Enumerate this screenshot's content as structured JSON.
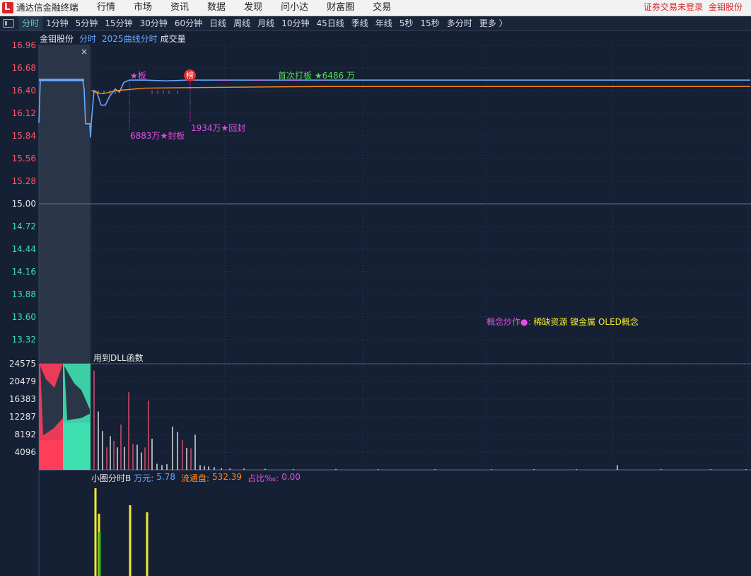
{
  "app": {
    "title": "通达信金融终端",
    "logo_glyph": "L"
  },
  "menu": [
    "行情",
    "市场",
    "资讯",
    "数据",
    "发现",
    "问小达",
    "财富圈",
    "交易"
  ],
  "right_menu": {
    "login": "证券交易未登录",
    "stock": "金钼股份"
  },
  "periods": [
    "分时",
    "1分钟",
    "5分钟",
    "15分钟",
    "30分钟",
    "60分钟",
    "日线",
    "周线",
    "月线",
    "10分钟",
    "45日线",
    "季线",
    "年线",
    "5秒",
    "15秒",
    "多分时",
    "更多 〉"
  ],
  "active_period": "分时",
  "header": {
    "stock": "金钼股份",
    "tab1": "分时",
    "tab2": "2025曲线分时",
    "tab3": "成交量"
  },
  "close_icon": "×",
  "price_ticks": [
    "16.96",
    "16.68",
    "16.40",
    "16.12",
    "15.84",
    "15.56",
    "15.28",
    "15.00",
    "14.72",
    "14.44",
    "14.16",
    "13.88",
    "13.60",
    "13.32"
  ],
  "vol_ticks": [
    "24575",
    "20479",
    "16383",
    "12287",
    "8192",
    "4096"
  ],
  "annotations": {
    "star_board": "★板",
    "bang": "榜",
    "first_limit": "首次打板 ★6486 万",
    "seal1": "6883万★封板",
    "seal2": "1934万★回封"
  },
  "concept": {
    "label": "概念炒作●:",
    "values": "稀缺资源 镍金属 OLED概念"
  },
  "dll_label": "用到DLL函数",
  "panel3": {
    "name": "小圈分时B",
    "unit_label": "万元:",
    "unit_value": "5.78",
    "float_label": "流通盘:",
    "float_value": "532.39",
    "ratio_label": "占比‰:",
    "ratio_value": "0.00"
  },
  "colors": {
    "up": "#ff3c5a",
    "down": "#3ee0b0",
    "price": "#6aa8ff",
    "avg": "#ff8a1c",
    "magenta": "#e64de6",
    "green": "#4cdc4c",
    "yellow": "#f2ea2b",
    "axis_red": "#ff5566",
    "axis_green": "#3ee0b0"
  },
  "chart_data": {
    "type": "line",
    "title": "金钼股份",
    "prev_close": 15.0,
    "ylim": [
      13.32,
      16.96
    ],
    "price_points": [
      [
        0,
        16.0
      ],
      [
        2,
        16.53
      ],
      [
        30,
        16.53
      ],
      [
        62,
        16.53
      ],
      [
        64,
        16.42
      ],
      [
        66,
        15.99
      ],
      [
        72,
        15.99
      ],
      [
        73,
        15.82
      ],
      [
        74,
        15.99
      ],
      [
        78,
        16.4
      ],
      [
        82,
        16.38
      ],
      [
        88,
        16.22
      ],
      [
        94,
        16.22
      ],
      [
        100,
        16.33
      ],
      [
        108,
        16.42
      ],
      [
        114,
        16.38
      ],
      [
        120,
        16.5
      ],
      [
        128,
        16.53
      ],
      [
        150,
        16.53
      ],
      [
        180,
        16.52
      ],
      [
        210,
        16.53
      ],
      [
        250,
        16.53
      ],
      [
        350,
        16.53
      ],
      [
        500,
        16.53
      ],
      [
        1006,
        16.53
      ]
    ],
    "avg_points": [
      [
        74,
        16.4
      ],
      [
        80,
        16.38
      ],
      [
        90,
        16.36
      ],
      [
        110,
        16.4
      ],
      [
        150,
        16.43
      ],
      [
        250,
        16.44
      ],
      [
        400,
        16.45
      ],
      [
        550,
        16.45
      ],
      [
        1006,
        16.45
      ]
    ],
    "volume_ylim": [
      0,
      24575
    ],
    "premarket_volume": {
      "red_top": 24575,
      "red_level": 7000,
      "green_top": 24575,
      "green_level": 11000
    },
    "volume_bars": [
      {
        "x": 78,
        "v": 23000,
        "c": "up"
      },
      {
        "x": 84,
        "v": 13500,
        "c": "down"
      },
      {
        "x": 90,
        "v": 9000,
        "c": "down"
      },
      {
        "x": 96,
        "v": 5200,
        "c": "up"
      },
      {
        "x": 101,
        "v": 7800,
        "c": "down"
      },
      {
        "x": 106,
        "v": 6700,
        "c": "up"
      },
      {
        "x": 111,
        "v": 5200,
        "c": "down"
      },
      {
        "x": 116,
        "v": 10500,
        "c": "up"
      },
      {
        "x": 121,
        "v": 5300,
        "c": "down"
      },
      {
        "x": 127,
        "v": 18000,
        "c": "up"
      },
      {
        "x": 133,
        "v": 6000,
        "c": "up"
      },
      {
        "x": 139,
        "v": 5800,
        "c": "down"
      },
      {
        "x": 145,
        "v": 4000,
        "c": "down"
      },
      {
        "x": 150,
        "v": 5200,
        "c": "up"
      },
      {
        "x": 155,
        "v": 16000,
        "c": "up"
      },
      {
        "x": 160,
        "v": 7200,
        "c": "down"
      },
      {
        "x": 167,
        "v": 1400,
        "c": "down"
      },
      {
        "x": 174,
        "v": 1100,
        "c": "down"
      },
      {
        "x": 181,
        "v": 1300,
        "c": "down"
      },
      {
        "x": 189,
        "v": 10000,
        "c": "down"
      },
      {
        "x": 196,
        "v": 8800,
        "c": "down"
      },
      {
        "x": 203,
        "v": 6900,
        "c": "up"
      },
      {
        "x": 209,
        "v": 5100,
        "c": "down"
      },
      {
        "x": 215,
        "v": 5000,
        "c": "up"
      },
      {
        "x": 221,
        "v": 8100,
        "c": "down"
      },
      {
        "x": 228,
        "v": 1100,
        "c": "down"
      },
      {
        "x": 234,
        "v": 900,
        "c": "down"
      },
      {
        "x": 240,
        "v": 800,
        "c": "down"
      },
      {
        "x": 248,
        "v": 600,
        "c": "down"
      },
      {
        "x": 258,
        "v": 400,
        "c": "down"
      },
      {
        "x": 270,
        "v": 300,
        "c": "down"
      },
      {
        "x": 290,
        "v": 300,
        "c": "down"
      },
      {
        "x": 320,
        "v": 250,
        "c": "down"
      },
      {
        "x": 360,
        "v": 200,
        "c": "down"
      },
      {
        "x": 420,
        "v": 200,
        "c": "down"
      },
      {
        "x": 480,
        "v": 150,
        "c": "down"
      },
      {
        "x": 560,
        "v": 150,
        "c": "down"
      },
      {
        "x": 640,
        "v": 150,
        "c": "down"
      },
      {
        "x": 700,
        "v": 150,
        "c": "down"
      },
      {
        "x": 760,
        "v": 150,
        "c": "down"
      },
      {
        "x": 818,
        "v": 1100,
        "c": "down"
      },
      {
        "x": 880,
        "v": 150,
        "c": "down"
      },
      {
        "x": 950,
        "v": 150,
        "c": "down"
      },
      {
        "x": 1000,
        "v": 150,
        "c": "down"
      }
    ],
    "panel3_bars": [
      {
        "x": 80,
        "h": 124,
        "c": "yellow"
      },
      {
        "x": 85,
        "h": 88,
        "c": "yellow"
      },
      {
        "x": 86,
        "h": 62,
        "c": "green"
      },
      {
        "x": 129,
        "h": 100,
        "c": "yellow"
      },
      {
        "x": 153,
        "h": 90,
        "c": "yellow"
      }
    ]
  }
}
